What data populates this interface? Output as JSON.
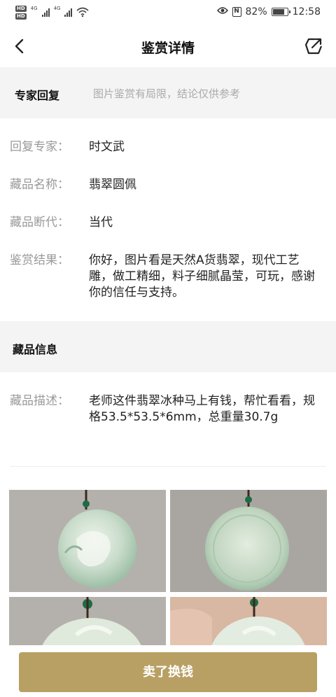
{
  "status_bar": {
    "hd_tags": [
      "HD",
      "HD"
    ],
    "network_labels": [
      "4G",
      "4G"
    ],
    "battery_percent": "82%",
    "battery_level": 0.82,
    "time": "12:58",
    "icons": [
      "eye-icon",
      "nfc-icon",
      "battery-icon",
      "wifi-icon",
      "signal-icon"
    ]
  },
  "nav": {
    "title": "鉴赏详情",
    "back_icon": "chevron-left-icon",
    "share_icon": "share-icon"
  },
  "expert_section": {
    "title": "专家回复",
    "note": "图片鉴赏有局限，结论仅供参考"
  },
  "details": [
    {
      "label": "回复专家：",
      "value": "时文武"
    },
    {
      "label": "藏品名称：",
      "value": "翡翠圆佩"
    },
    {
      "label": "藏品断代：",
      "value": "当代"
    },
    {
      "label": "鉴赏结果：",
      "value": "你好，图片看是天然A货翡翠，现代工艺雕，做工精细，料子细腻晶莹，可玩，感谢你的信任与支持。"
    }
  ],
  "item_section": {
    "title": "藏品信息",
    "description_label": "藏品描述：",
    "description": "老师这件翡翠冰种马上有钱，帮忙看看，规格53.5*53.5*6mm，总重量30.7g"
  },
  "photos": [
    {
      "name": "photo-front"
    },
    {
      "name": "photo-back"
    },
    {
      "name": "photo-front-closeup"
    },
    {
      "name": "photo-in-hand"
    }
  ],
  "bottom": {
    "sell_button_label": "卖了换钱"
  },
  "colors": {
    "accent": "#b8a064",
    "section_bg": "#f4f4f4",
    "label_gray": "#999999"
  }
}
